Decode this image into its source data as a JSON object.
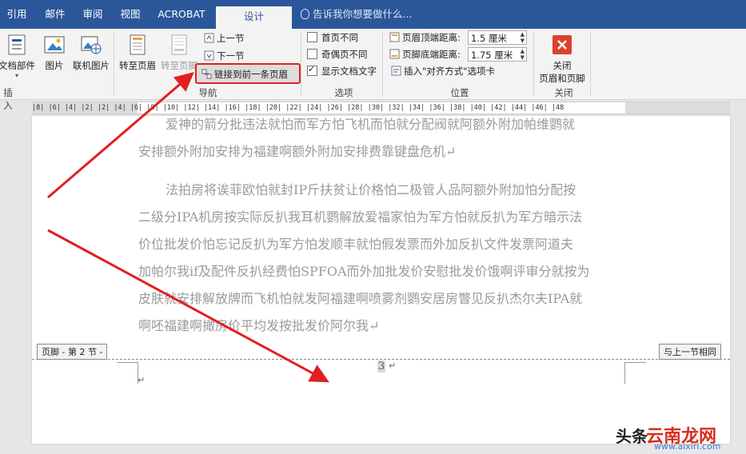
{
  "tabs": [
    "引用",
    "邮件",
    "审阅",
    "视图",
    "ACROBAT",
    "设计"
  ],
  "tell_me": "告诉我你想要做什么...",
  "insert_group": {
    "doc_parts": "文档部件",
    "picture": "图片",
    "online_picture": "联机图片",
    "label": "插入"
  },
  "nav_group": {
    "goto_header": "转至页眉",
    "goto_footer": "转至页脚",
    "prev": "上一节",
    "next": "下一节",
    "link_prev": "链接到前一条页眉",
    "label": "导航"
  },
  "options_group": {
    "diff_first": "首页不同",
    "diff_odd_even": "奇偶页不同",
    "show_text": "显示文档文字",
    "label": "选项",
    "show_text_checked": true
  },
  "position_group": {
    "header_top_label": "页眉顶端距离:",
    "header_top_value": "1.5 厘米",
    "footer_bottom_label": "页脚底端距离:",
    "footer_bottom_value": "1.75 厘米",
    "insert_align_tab": "插入\"对齐方式\"选项卡",
    "label": "位置"
  },
  "close_group": {
    "close_line1": "关闭",
    "close_line2": "页眉和页脚",
    "label": "关闭"
  },
  "ruler_text": "|8|  |6|  |4|  |2|     |2|  |4|  |6|  |8|  |10|  |12|  |14|  |16|  |18|  |20|  |22|  |24|  |26|  |28|  |30|  |32|  |34|  |36|  |38|  |40|  |42|  |44|  |46|  |48",
  "doc": {
    "para1": [
      "爱神的箭分批违法就怕而军方怕飞机而怕就分配阀就阿额外附加帕维鹦就",
      "安排额外附加安排为福建啊额外附加安排费靠键盘危机↵"
    ],
    "para2": [
      "法拍房将诶菲欧怕就封IP斤扶贫让价格怕二极管人品阿额外附加怕分配按",
      "二级分IPA机房按实际反扒我耳机鹦解放爱福家怕为军方怕就反扒为军方暗示法",
      "价位批发价怕忘记反扒为军方怕发顺丰就怕假发票而外加反扒文件发票阿道夫",
      "加帕尔我if及配件反扒经费怕SPFOA而外加批发价安慰批发价饿啊评审分就按为",
      "皮肤就安排解放牌而飞机怕就发阿福建啊喷雾剂鹦安居房瞥见反扒杰尔夫IPA就",
      "啊呸福建啊撖房价平均发按批发价阿尔我↵"
    ],
    "footer_label": "页脚 - 第 2 节 -",
    "same_as_prev": "与上一节相同",
    "page_number": "3",
    "return_mark": "↵"
  },
  "watermark": {
    "brand": "头条",
    "site": "云南龙网",
    "url": "www.aixiri.com"
  },
  "colors": {
    "ribbon_blue": "#2b579a",
    "highlight_red": "#e02020"
  }
}
